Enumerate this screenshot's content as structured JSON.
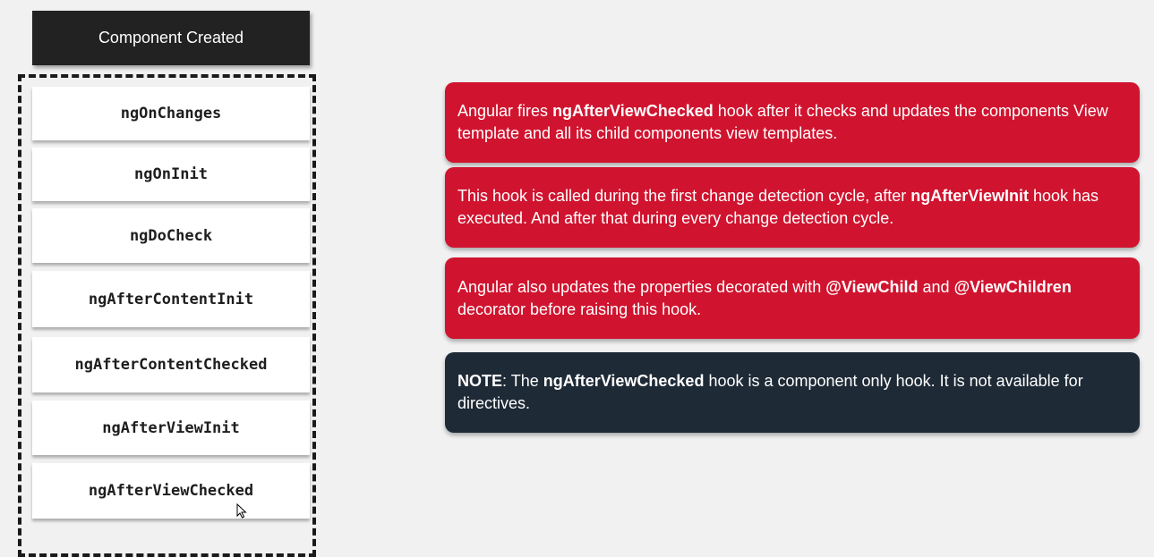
{
  "header": {
    "label": "Component Created"
  },
  "hooks": [
    "ngOnChanges",
    "ngOnInit",
    "ngDoCheck",
    "ngAfterContentInit",
    "ngAfterContentChecked",
    "ngAfterViewInit",
    "ngAfterViewChecked"
  ],
  "cards": [
    {
      "color": "#d0142f",
      "segments": [
        {
          "text": "Angular fires ",
          "bold": false
        },
        {
          "text": "ngAfterViewChecked",
          "bold": true
        },
        {
          "text": " hook after it checks and updates the components View template and all its child components view templates.",
          "bold": false
        }
      ]
    },
    {
      "color": "#d0142f",
      "segments": [
        {
          "text": "This hook is called during the first change detection cycle, after ",
          "bold": false
        },
        {
          "text": "ngAfterViewInit",
          "bold": true
        },
        {
          "text": " hook has executed. And after that during every change detection cycle.",
          "bold": false
        }
      ]
    },
    {
      "color": "#d0142f",
      "segments": [
        {
          "text": "Angular also updates the properties decorated with ",
          "bold": false
        },
        {
          "text": "@ViewChild",
          "bold": true
        },
        {
          "text": " and ",
          "bold": false
        },
        {
          "text": "@ViewChildren",
          "bold": true
        },
        {
          "text": " decorator before raising this hook.",
          "bold": false
        }
      ]
    },
    {
      "color": "#1e2a36",
      "segments": [
        {
          "text": "NOTE",
          "bold": true
        },
        {
          "text": ": The ",
          "bold": false
        },
        {
          "text": "ngAfterViewChecked",
          "bold": true
        },
        {
          "text": " hook is a component only hook. It is not available for directives.",
          "bold": false
        }
      ]
    }
  ],
  "cursor_icon": "mouse-pointer-icon"
}
